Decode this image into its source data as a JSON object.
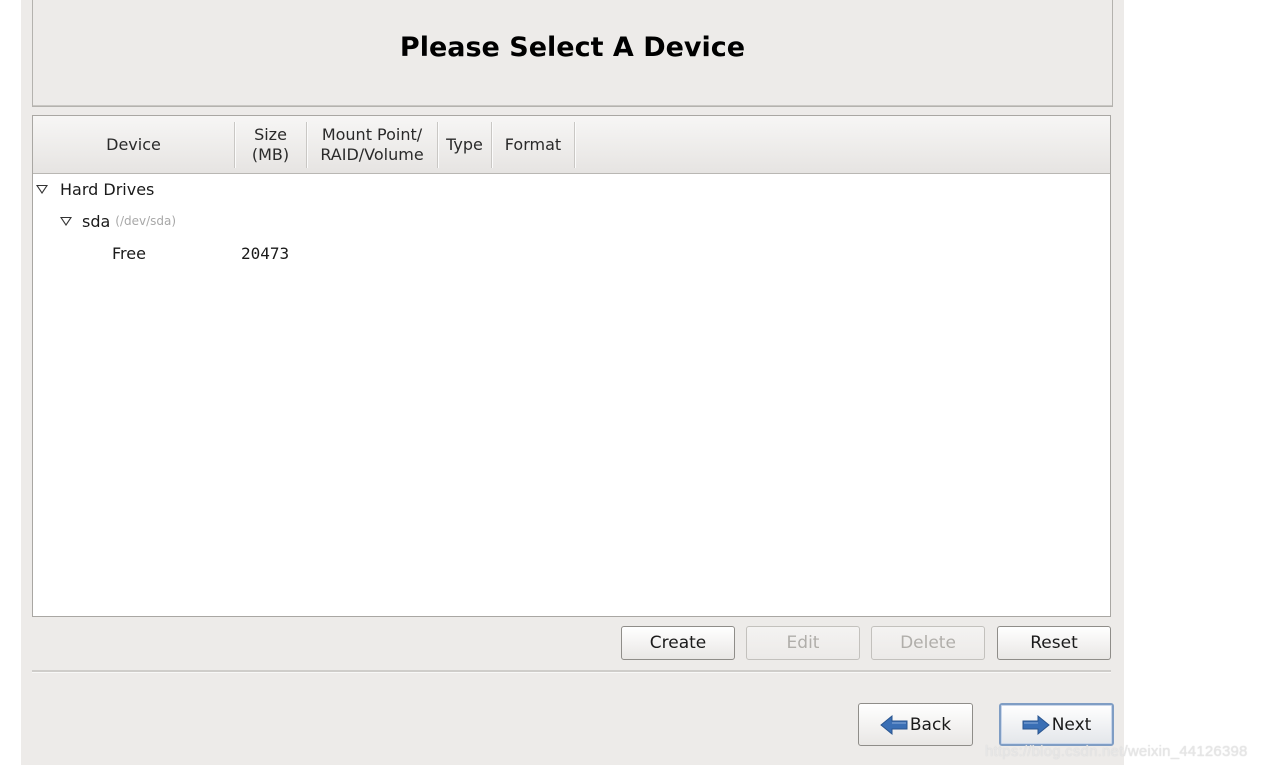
{
  "header": {
    "title": "Please Select A Device"
  },
  "table": {
    "columns": [
      {
        "label_line1": "Device",
        "label_line2": ""
      },
      {
        "label_line1": "Size",
        "label_line2": "(MB)"
      },
      {
        "label_line1": "Mount Point/",
        "label_line2": "RAID/Volume"
      },
      {
        "label_line1": "Type",
        "label_line2": ""
      },
      {
        "label_line1": "Format",
        "label_line2": ""
      }
    ],
    "rows": [
      {
        "device": "Hard Drives",
        "expanded": true,
        "level": 0
      },
      {
        "device": "sda",
        "path": "(/dev/sda)",
        "expanded": true,
        "level": 1
      },
      {
        "device": "Free",
        "size": "20473",
        "level": 2
      }
    ]
  },
  "actions": {
    "create": "Create",
    "edit": "Edit",
    "delete": "Delete",
    "reset": "Reset"
  },
  "nav": {
    "back": "Back",
    "next": "Next"
  },
  "colors": {
    "arrow_blue": "#3a6fb5",
    "window_bg": "#edebe9"
  },
  "watermark": "https://blog.csdn.net/weixin_44126398"
}
